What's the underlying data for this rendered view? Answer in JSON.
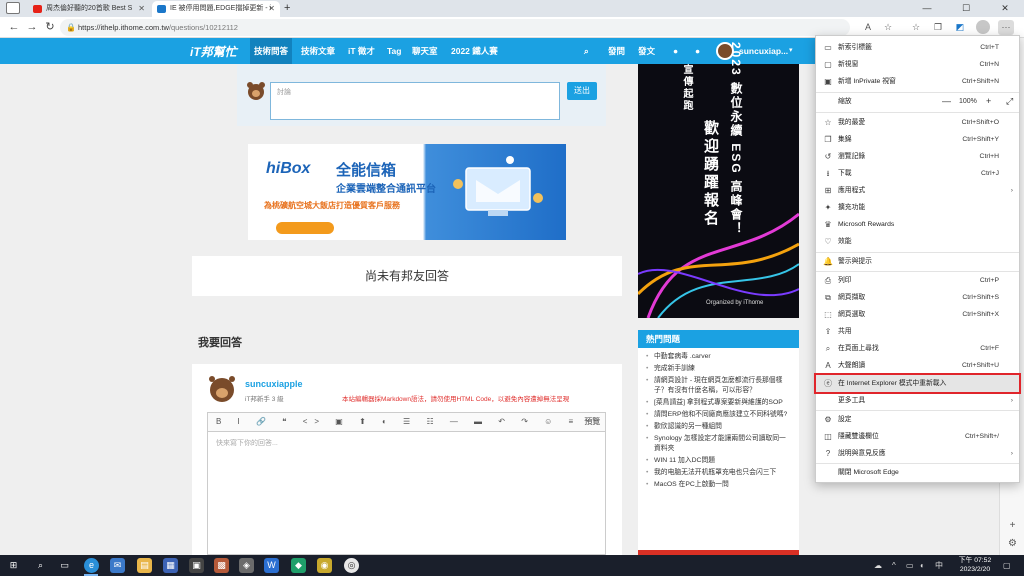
{
  "browser": {
    "tabs": [
      {
        "title": "周杰倫好聽的20首歌 Best S",
        "favicon_color": "#e62117"
      },
      {
        "title": "IE 被停用問題,EDGE擋掉更新 - i",
        "favicon_color": "#1b77c9"
      }
    ],
    "url_host": "https://ithelp.ithome.com.tw",
    "url_path": "/questions/10212112",
    "new_tab_symbol": "+",
    "minimize_symbol": "—",
    "maximize_symbol": "☐",
    "close_symbol": "✕"
  },
  "site": {
    "logo": "iT邦幫忙",
    "nav": [
      "技術問答",
      "技術文章",
      "iT 徵才",
      "Tag",
      "聊天室",
      "2022 鐵人賽"
    ],
    "right": {
      "ask": "發問",
      "post": "發文",
      "username": "suncuxiap..."
    },
    "accent": "#1ba1e2"
  },
  "comment": {
    "placeholder": "討論",
    "send": "送出"
  },
  "ad": {
    "brand": "hiBox",
    "title": "全能信箱",
    "subtitle": "企業雲端整合通訊平台",
    "promo": "為桃礦航空城大飯店打造優質客戶服務"
  },
  "no_answer": "尚未有邦友回答",
  "my_answer": {
    "title": "我要回答",
    "username": "suncuxiapple",
    "level": "iT邦新手 3 級",
    "markdown_hint": "本站編輯器採Markdown語法，請勿使用HTML Code，以避免內容遭掉無法呈現",
    "toolbar": "B I 🔗 ❝ <> ▣ ⬆ ◐ ☰ ☷ — ▬ ↶ ↷ ☺ ≡",
    "preview": "預覽",
    "placeholder": "快來寫下你的回答..."
  },
  "event_banner": {
    "line1": "2023 數位永續 ESG 高峰會！",
    "line2": "歡迎踴躍報名",
    "line3": "宣傳起跑",
    "organized": "Organized by iThome"
  },
  "hot": {
    "title": "熱門問題",
    "items": [
      "中勤套病毒 .carver",
      "完成新手訓練",
      "請網頁設計 - 現在網頁怎麼都流行長那個樣子？有沒有什麼名稱，可以形容？",
      "[菜鳥請益] 拿到程式專案要新與維護的SOP",
      "請問ERP他和不同廠商應該建立不同科號嗎?",
      "歡欣認識的另一種組問",
      "Synology 怎樣設定才能讓兩間公司讀取同一資料夾",
      "WIN 11 加入DC問題",
      "我的电脑无法开机瓶罩充电也只会闪三下",
      "MacOS 在PC上啟動一問"
    ]
  },
  "menu": {
    "items": [
      {
        "label": "新索引標籤",
        "shortcut": "Ctrl+T",
        "icon": "new-tab-icon"
      },
      {
        "label": "新視窗",
        "shortcut": "Ctrl+N",
        "icon": "new-window-icon"
      },
      {
        "label": "新增 InPrivate 視窗",
        "shortcut": "Ctrl+Shift+N",
        "icon": "inprivate-icon"
      },
      {
        "label": "縮放",
        "zoom": "100%",
        "icon": "zoom-icon"
      },
      {
        "label": "我的最愛",
        "shortcut": "Ctrl+Shift+O",
        "icon": "favorites-icon"
      },
      {
        "label": "集錦",
        "shortcut": "Ctrl+Shift+Y",
        "icon": "collections-icon"
      },
      {
        "label": "瀏覽記錄",
        "shortcut": "Ctrl+H",
        "icon": "history-icon"
      },
      {
        "label": "下載",
        "shortcut": "Ctrl+J",
        "icon": "download-icon"
      },
      {
        "label": "應用程式",
        "shortcut": "",
        "icon": "apps-icon",
        "submenu": true
      },
      {
        "label": "擴充功能",
        "shortcut": "",
        "icon": "extensions-icon"
      },
      {
        "label": "Microsoft Rewards",
        "shortcut": "",
        "icon": "rewards-icon"
      },
      {
        "label": "效能",
        "shortcut": "",
        "icon": "performance-icon"
      },
      {
        "label": "警示與提示",
        "shortcut": "",
        "icon": "alerts-icon"
      },
      {
        "label": "列印",
        "shortcut": "Ctrl+P",
        "icon": "print-icon"
      },
      {
        "label": "網頁擷取",
        "shortcut": "Ctrl+Shift+S",
        "icon": "web-capture-icon"
      },
      {
        "label": "網頁選取",
        "shortcut": "Ctrl+Shift+X",
        "icon": "web-select-icon"
      },
      {
        "label": "共用",
        "shortcut": "",
        "icon": "share-icon"
      },
      {
        "label": "在頁面上尋找",
        "shortcut": "Ctrl+F",
        "icon": "find-icon"
      },
      {
        "label": "大聲朗讀",
        "shortcut": "Ctrl+Shift+U",
        "icon": "read-aloud-icon"
      },
      {
        "label": "在 Internet Explorer 模式中重新載入",
        "shortcut": "",
        "icon": "ie-mode-icon"
      },
      {
        "label": "更多工具",
        "shortcut": "",
        "icon": "",
        "submenu": true
      },
      {
        "label": "設定",
        "shortcut": "",
        "icon": "settings-icon"
      },
      {
        "label": "隱藏雙邊欄位",
        "shortcut": "Ctrl+Shift+/",
        "icon": "sidebar-icon"
      },
      {
        "label": "說明與意見反應",
        "shortcut": "",
        "icon": "help-icon",
        "submenu": true
      },
      {
        "label": "關閉 Microsoft Edge",
        "shortcut": "",
        "icon": ""
      }
    ],
    "zoom_minus": "—",
    "zoom_plus": "+",
    "highlight_color": "#e0252b"
  },
  "taskbar": {
    "time": "下午 07:52",
    "date": "2023/2/20",
    "lang": "中"
  }
}
